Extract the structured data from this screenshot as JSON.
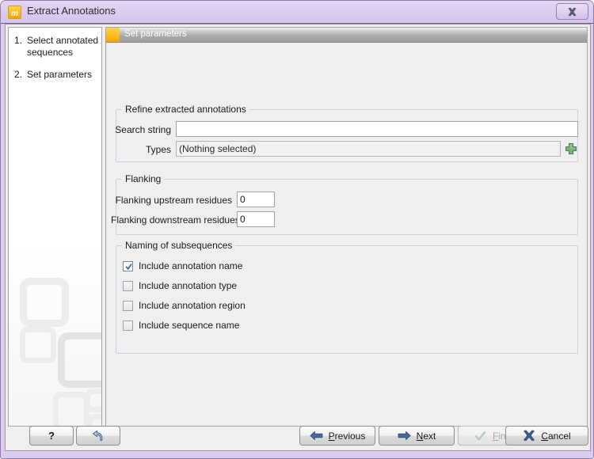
{
  "window": {
    "title": "Extract Annotations",
    "app_icon": "m",
    "close_icon": "close-icon",
    "close_label": "X"
  },
  "sidebar": {
    "steps": [
      {
        "num": "1.",
        "label": "Select annotated sequences"
      },
      {
        "num": "2.",
        "label": "Set parameters"
      }
    ]
  },
  "content": {
    "header": {
      "title": "Set parameters"
    },
    "refine_group": {
      "title": "Refine extracted annotations",
      "search_string": {
        "label": "Search string",
        "value": "",
        "placeholder": ""
      },
      "types": {
        "label": "Types",
        "value": "(Nothing selected)"
      },
      "add_button": {
        "icon": "plus-icon",
        "label": "+"
      }
    },
    "flanking_group": {
      "title": "Flanking",
      "upstream": {
        "label": "Flanking upstream residues",
        "value": "0"
      },
      "downstream": {
        "label": "Flanking downstream residues",
        "value": "0"
      }
    },
    "naming_group": {
      "title": "Naming of subsequences",
      "checkboxes": [
        {
          "label": "Include annotation name",
          "checked": true
        },
        {
          "label": "Include annotation type",
          "checked": false
        },
        {
          "label": "Include annotation region",
          "checked": false
        },
        {
          "label": "Include sequence name",
          "checked": false
        }
      ]
    }
  },
  "buttonbar": {
    "help": {
      "label": "?",
      "icon": "question-mark-icon"
    },
    "reset": {
      "label": "",
      "icon": "undo-arrow-icon"
    },
    "previous": {
      "label": "Previous",
      "mnemonic": "P",
      "rest": "revious",
      "icon": "arrow-left-icon",
      "enabled": true
    },
    "next": {
      "label": "Next",
      "mnemonic": "N",
      "rest": "ext",
      "icon": "arrow-right-icon",
      "enabled": true
    },
    "finish": {
      "label": "Finish",
      "mnemonic": "F",
      "rest": "inish",
      "icon": "checkmark-icon",
      "enabled": false
    },
    "cancel": {
      "label": "Cancel",
      "mnemonic": "C",
      "rest": "ancel",
      "icon": "cross-icon",
      "enabled": true
    }
  },
  "colors": {
    "title_bar": "#dccdf0",
    "accent_orange": "#ffbe1f",
    "header_gray": "#a9a9a9",
    "checkmark_blue": "#3a6ea5",
    "plus_green": "#6aa06a",
    "arrow_blue": "#3f5f8f"
  }
}
